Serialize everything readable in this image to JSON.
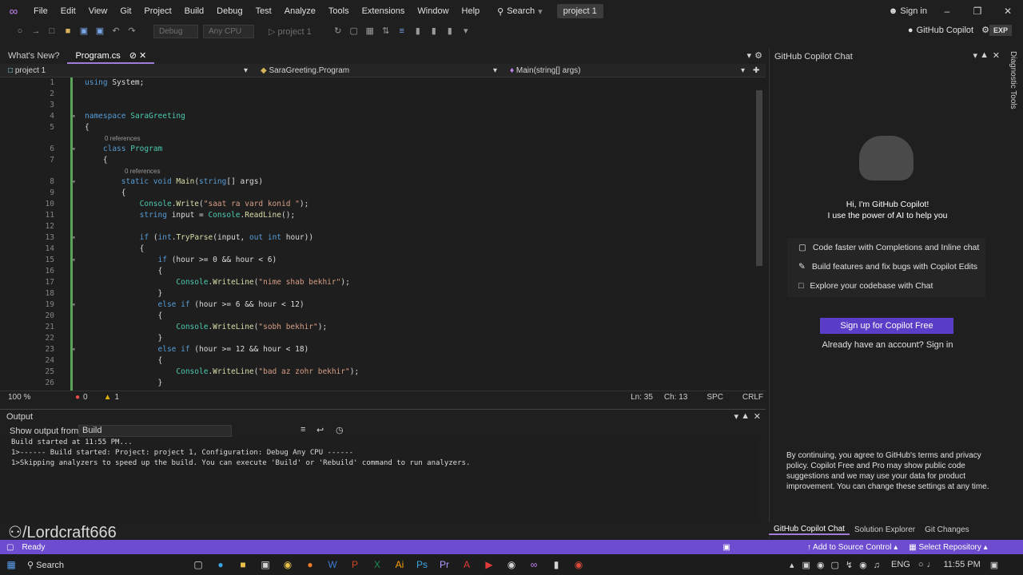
{
  "menubar": {
    "items": [
      "File",
      "Edit",
      "View",
      "Git",
      "Project",
      "Build",
      "Debug",
      "Test",
      "Analyze",
      "Tools",
      "Extensions",
      "Window",
      "Help"
    ],
    "search": "Search",
    "project": "project 1",
    "sign_in": "Sign in"
  },
  "toolbar": {
    "config": "Debug",
    "platform": "Any CPU",
    "run_target": "project 1",
    "copilot": "GitHub Copilot",
    "exp": "EXP"
  },
  "tabs": {
    "whats_new": "What's New?",
    "program": "Program.cs"
  },
  "navbar": {
    "project": "project 1",
    "class": "SaraGreeting.Program",
    "method": "Main(string[] args)"
  },
  "refs": {
    "class": "0 references",
    "method": "0 references"
  },
  "statusline": {
    "zoom": "100 %",
    "errors": "0",
    "warnings": "1",
    "position": "Ln: 35",
    "col": "Ch: 13",
    "enc": "SPC",
    "eol": "CRLF"
  },
  "output": {
    "title": "Output",
    "show_from": "Show output from:",
    "source": "Build",
    "lines": [
      "Build started at 11:55 PM...",
      "1>------ Build started: Project: project 1, Configuration: Debug Any CPU ------",
      "1>Skipping analyzers to speed up the build. You can execute 'Build' or 'Rebuild' command to run analyzers."
    ]
  },
  "copilot": {
    "title": "GitHub Copilot Chat",
    "greeting": "Hi, I'm GitHub Copilot!",
    "subtitle": "I use the power of AI to help you",
    "features": [
      "Code faster with Completions and Inline chat",
      "Build features and fix bugs with Copilot Edits",
      "Explore your codebase with Chat"
    ],
    "signup": "Sign up for Copilot Free",
    "have_account": "Already have an account?",
    "signin": "Sign in",
    "legal": "By continuing, you agree to GitHub's terms and privacy policy. Copilot Free and Pro may show public code suggestions and we may use your data for product improvement. You can change these settings at any time."
  },
  "bottomtabs": [
    "GitHub Copilot Chat",
    "Solution Explorer",
    "Git Changes"
  ],
  "diag": "Diagnostic Tools",
  "statusbar": {
    "ready": "Ready",
    "add_source": "Add to Source Control",
    "select_repo": "Select Repository"
  },
  "taskbar": {
    "search": "Search",
    "lang": "ENG",
    "time": "11:55 PM"
  },
  "watermark": "/Lordcraft666",
  "colors": {
    "accent": "#6d4ccf",
    "signup": "#5b3ec8"
  }
}
